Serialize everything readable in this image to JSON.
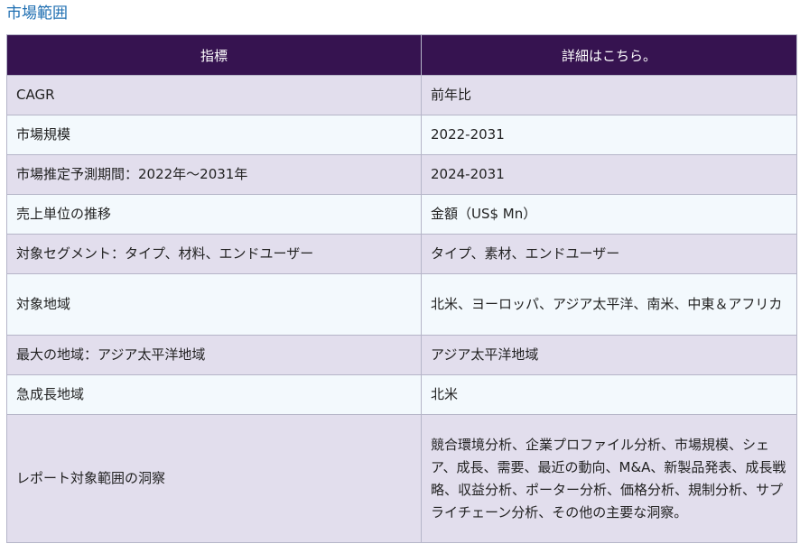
{
  "section_title": "市場範囲",
  "table": {
    "headers": [
      "指標",
      "詳細はこちら。"
    ],
    "rows": [
      {
        "metric": "CAGR",
        "detail": "前年比"
      },
      {
        "metric": "市場規模",
        "detail": "2022-2031"
      },
      {
        "metric": "市場推定予測期間：2022年～2031年",
        "detail": "2024-2031"
      },
      {
        "metric": "売上単位の推移",
        "detail": "金額（US$ Mn）"
      },
      {
        "metric": "対象セグメント：タイプ、材料、エンドユーザー",
        "detail": "タイプ、素材、エンドユーザー"
      },
      {
        "metric": "対象地域",
        "detail": "北米、ヨーロッパ、アジア太平洋、南米、中東＆アフリカ"
      },
      {
        "metric": "最大の地域：アジア太平洋地域",
        "detail": "アジア太平洋地域"
      },
      {
        "metric": "急成長地域",
        "detail": "北米"
      },
      {
        "metric": "レポート対象範囲の洞察",
        "detail": "競合環境分析、企業プロファイル分析、市場規模、シェア、成長、需要、最近の動向、M&A、新製品発表、成長戦略、収益分析、ポーター分析、価格分析、規制分析、サプライチェーン分析、その他の主要な洞察。"
      }
    ]
  }
}
